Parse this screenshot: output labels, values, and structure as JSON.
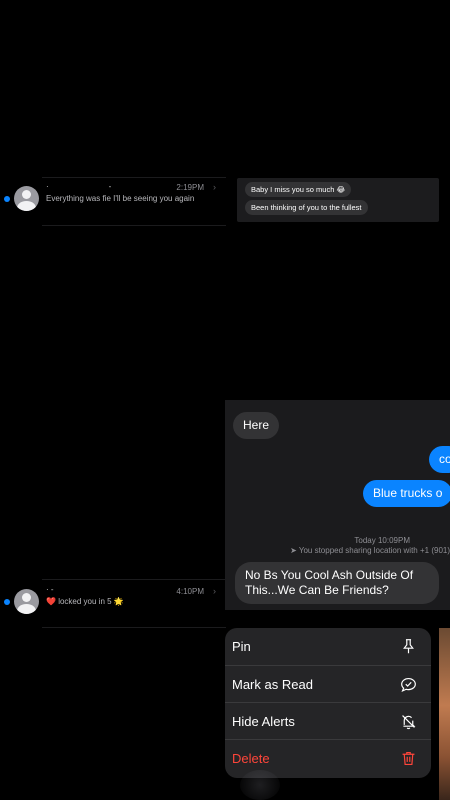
{
  "conversations": [
    {
      "name_left": "·",
      "name_right": "-",
      "time": "2:19PM",
      "preview": "Everything was fie I'll be seeing you again",
      "unread": true
    },
    {
      "name_left": "· -",
      "name_right": "",
      "time": "4:10PM",
      "preview_emoji_start": "❤️",
      "preview": "locked you in 5",
      "preview_emoji_end": "🌟",
      "unread": true
    }
  ],
  "peek_top": {
    "messages": [
      {
        "text": "Baby I miss you so much 😂"
      },
      {
        "text": "Been thinking of you to the fullest"
      }
    ]
  },
  "chat_preview": {
    "messages": [
      {
        "text": "Here",
        "direction": "incoming"
      },
      {
        "text": "co",
        "direction": "outgoing"
      },
      {
        "text": "Blue trucks o",
        "direction": "outgoing"
      },
      {
        "text": "No Bs You Cool Ash Outside Of This...We Can Be Friends?",
        "direction": "incoming"
      }
    ],
    "timestamp": "Today 10:09PM",
    "location_notice": "You stopped sharing location with +1 (901)"
  },
  "context_menu": {
    "items": [
      {
        "label": "Pin",
        "icon": "pin-icon"
      },
      {
        "label": "Mark as Read",
        "icon": "checkmark-bubble-icon"
      },
      {
        "label": "Hide Alerts",
        "icon": "bell-slash-icon"
      },
      {
        "label": "Delete",
        "icon": "trash-icon",
        "destructive": true
      }
    ]
  },
  "colors": {
    "accent": "#0a84ff",
    "destructive": "#ff453a",
    "background": "#000000",
    "bubble_incoming": "#333335"
  }
}
